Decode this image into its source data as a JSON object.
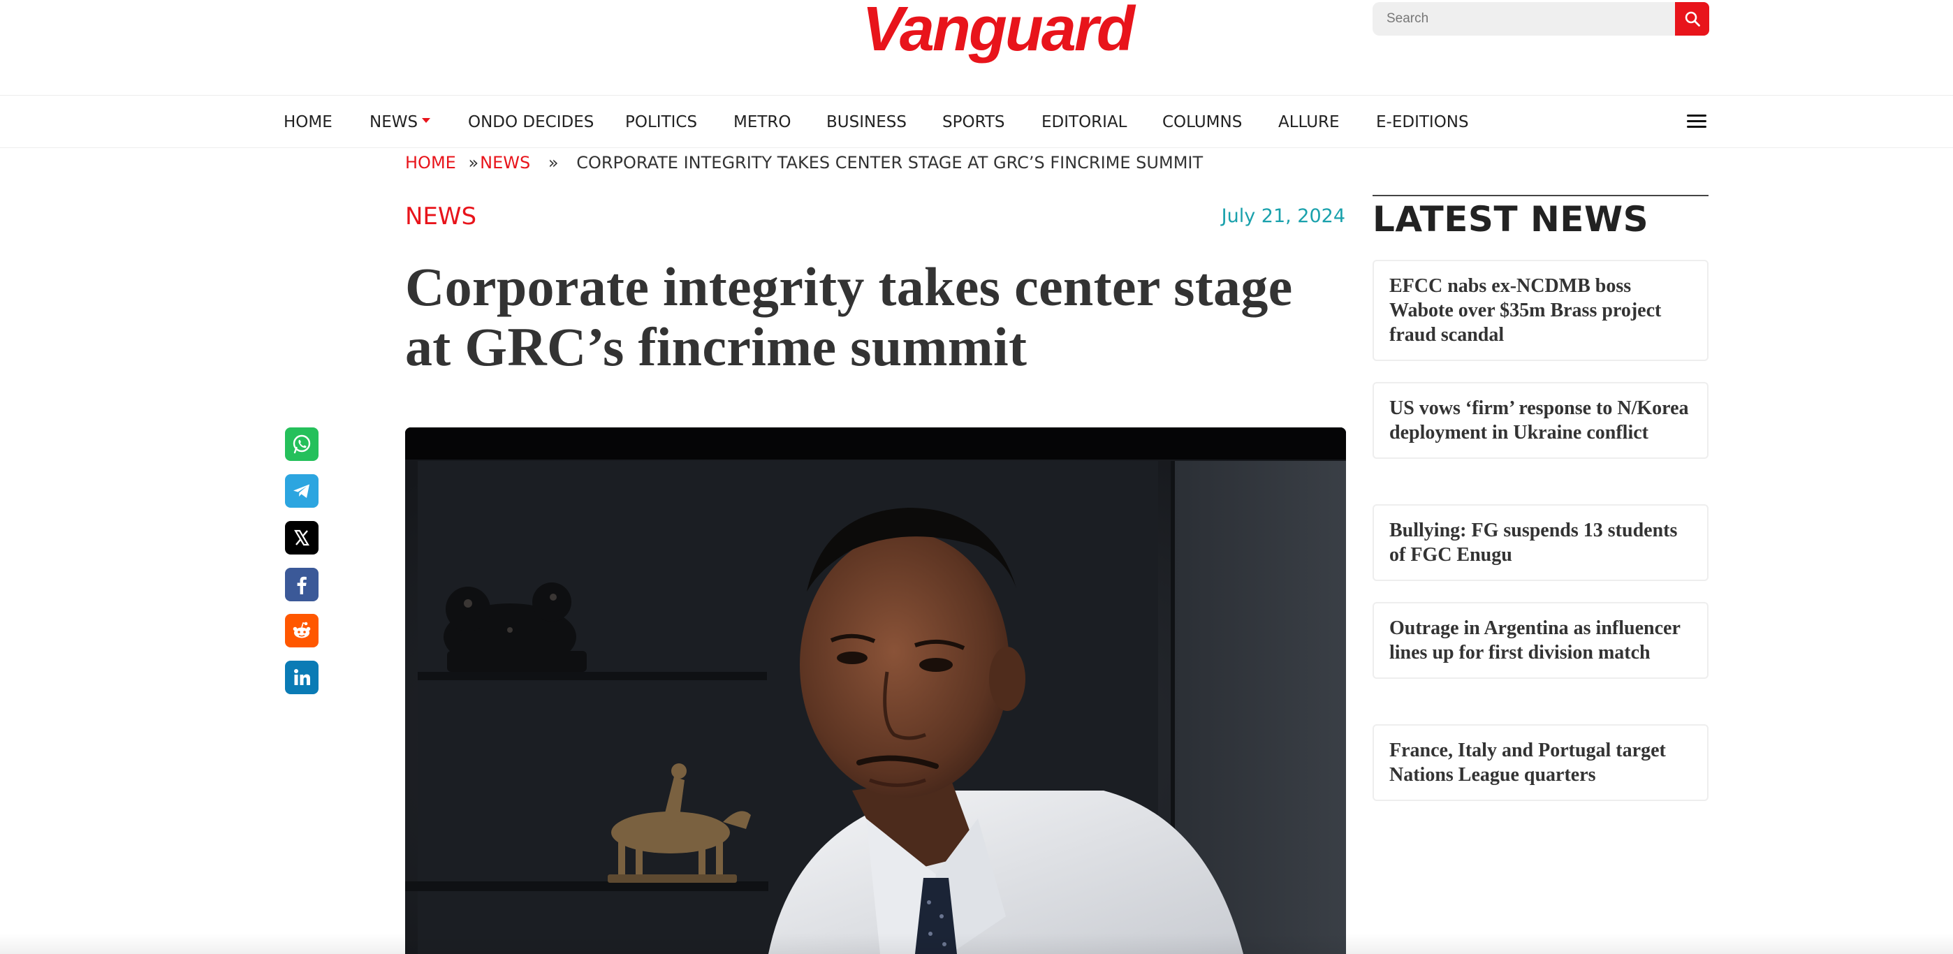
{
  "brand": {
    "logo_text": "Vanguard",
    "accent_color": "#e8141b",
    "date_color": "#1aa1ac"
  },
  "search": {
    "placeholder": "Search",
    "icon": "search-icon"
  },
  "nav": {
    "items": [
      {
        "label": "HOME"
      },
      {
        "label": "NEWS",
        "has_dropdown": true
      },
      {
        "label": "ONDO DECIDES"
      },
      {
        "label": "POLITICS"
      },
      {
        "label": "METRO"
      },
      {
        "label": "BUSINESS"
      },
      {
        "label": "SPORTS"
      },
      {
        "label": "EDITORIAL"
      },
      {
        "label": "COLUMNS"
      },
      {
        "label": "ALLURE"
      },
      {
        "label": "E-EDITIONS"
      }
    ],
    "menu_icon": "hamburger-menu-icon"
  },
  "breadcrumb": {
    "items": [
      {
        "label": "HOME"
      },
      {
        "label": "NEWS"
      }
    ],
    "separator": "»",
    "current": "CORPORATE INTEGRITY TAKES CENTER STAGE AT GRC’S FINCRIME SUMMIT"
  },
  "article": {
    "category": "NEWS",
    "date": "July 21, 2024",
    "title": "Corporate integrity takes center stage at GRC’s fincrime summit"
  },
  "share": [
    {
      "network": "whatsapp",
      "icon": "whatsapp-icon",
      "color": "#25c05b"
    },
    {
      "network": "telegram",
      "icon": "telegram-icon",
      "color": "#2ca5e0"
    },
    {
      "network": "x",
      "icon": "x-icon",
      "color": "#000000"
    },
    {
      "network": "facebook",
      "icon": "facebook-icon",
      "color": "#3b5998"
    },
    {
      "network": "reddit",
      "icon": "reddit-icon",
      "color": "#ff5700"
    },
    {
      "network": "linkedin",
      "icon": "linkedin-icon",
      "color": "#0a7bb5"
    }
  ],
  "sidebar": {
    "title": "LATEST NEWS",
    "items": [
      {
        "title": "EFCC nabs ex-NCDMB boss Wabote over $35m Brass project fraud scandal"
      },
      {
        "title": "US vows ‘firm’ response to N/Korea deployment in Ukraine conflict"
      },
      {
        "title": "Bullying: FG suspends 13 students of FGC Enugu"
      },
      {
        "title": "Outrage in Argentina as influencer lines up for first division match"
      },
      {
        "title": "France, Italy and Portugal target Nations League quarters"
      }
    ]
  }
}
